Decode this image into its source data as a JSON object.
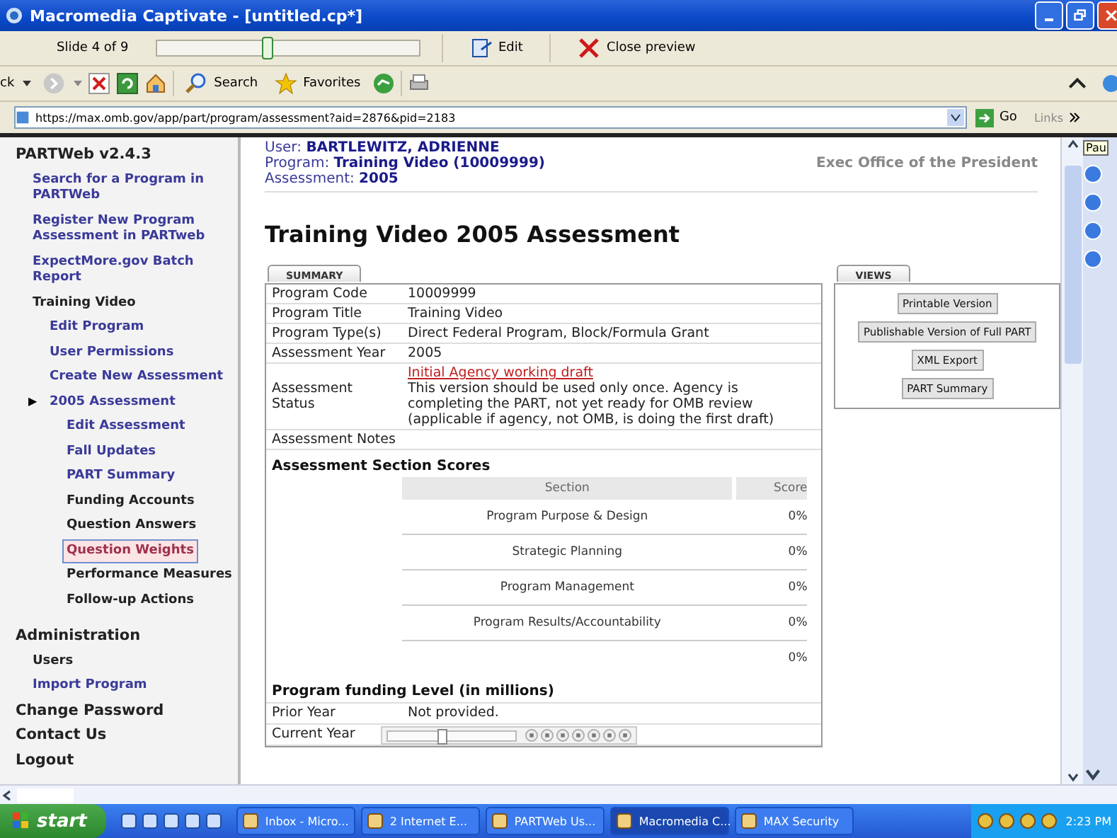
{
  "window": {
    "title": "Macromedia Captivate - [untitled.cp*]"
  },
  "preview_bar": {
    "slide_label": "Slide 4 of 9",
    "progress": {
      "level": 0.42
    },
    "edit_button": "Edit",
    "close_button": "Close preview"
  },
  "browser_toolbar": {
    "back_button": "ck",
    "search_button": "Search",
    "favorites_button": "Favorites"
  },
  "address_bar": {
    "url": "https://max.omb.gov/app/part/program/assessment?aid=2876&pid=2183",
    "go_button": "Go",
    "links_label": "Links"
  },
  "sidebar": {
    "items": [
      {
        "label": "PARTWeb v2.4.3",
        "kind": "heading",
        "selected": false,
        "children": [
          {
            "label": "Search for a Program in PARTWeb",
            "kind": "link",
            "selected": false
          },
          {
            "label": "Register New Program Assessment in PARTweb",
            "kind": "link",
            "selected": false
          },
          {
            "label": "ExpectMore.gov Batch Report",
            "kind": "link",
            "selected": false
          },
          {
            "label": "Training Video",
            "kind": "plain",
            "selected": false,
            "children": [
              {
                "label": "Edit Program",
                "kind": "link",
                "selected": false
              },
              {
                "label": "User Permissions",
                "kind": "link",
                "selected": false
              },
              {
                "label": "Create New Assessment",
                "kind": "link",
                "selected": false
              },
              {
                "label": "2005 Assessment",
                "kind": "link",
                "marker": "▶",
                "selected": false,
                "children": [
                  {
                    "label": "Edit Assessment",
                    "kind": "link",
                    "selected": false
                  },
                  {
                    "label": "Fall Updates",
                    "kind": "link",
                    "selected": false
                  },
                  {
                    "label": "PART Summary",
                    "kind": "link",
                    "selected": false
                  },
                  {
                    "label": "Funding Accounts",
                    "kind": "plain",
                    "selected": false
                  },
                  {
                    "label": "Question Answers",
                    "kind": "plain",
                    "selected": false
                  },
                  {
                    "label": "Question Weights",
                    "kind": "link",
                    "selected": true
                  },
                  {
                    "label": "Performance Measures",
                    "kind": "plain",
                    "selected": false
                  },
                  {
                    "label": "Follow-up Actions",
                    "kind": "plain",
                    "selected": false
                  }
                ]
              }
            ]
          }
        ]
      },
      {
        "label": "Administration",
        "kind": "heading",
        "selected": false,
        "children": [
          {
            "label": "Users",
            "kind": "plain",
            "selected": false
          },
          {
            "label": "Import Program",
            "kind": "link",
            "selected": false
          }
        ]
      },
      {
        "label": "Change Password",
        "kind": "major",
        "selected": false
      },
      {
        "label": "Contact Us",
        "kind": "major",
        "selected": false
      },
      {
        "label": "Logout",
        "kind": "major",
        "selected": false
      }
    ]
  },
  "header": {
    "fields": [
      {
        "label": "User:",
        "value": "BARTLEWITZ, ADRIENNE"
      },
      {
        "label": "Program:",
        "value": "Training Video (10009999)"
      },
      {
        "label": "Assessment:",
        "value": "2005"
      }
    ],
    "agency": "Exec Office of the President"
  },
  "page_title": "Training Video 2005 Assessment",
  "summary": {
    "tab": "SUMMARY",
    "rows": [
      {
        "label": "Program Code",
        "value": "10009999"
      },
      {
        "label": "Program Title",
        "value": "Training Video"
      },
      {
        "label": "Program Type(s)",
        "value": "Direct Federal Program, Block/Formula Grant"
      },
      {
        "label": "Assessment Year",
        "value": "2005"
      },
      {
        "label": "Assessment Status",
        "link": "Initial Agency working draft",
        "value": "This version should be used only once. Agency is completing the PART, not yet ready for OMB review (applicable if agency, not OMB, is doing the first draft)"
      },
      {
        "label": "Assessment Notes"
      }
    ]
  },
  "scores": {
    "heading": "Assessment Section Scores",
    "columns": [
      "Section",
      "Score"
    ],
    "rows": [
      {
        "section": "Program Purpose & Design",
        "score": "0%"
      },
      {
        "section": "Strategic Planning",
        "score": "0%"
      },
      {
        "section": "Program Management",
        "score": "0%"
      },
      {
        "section": "Program Results/Accountability",
        "score": "0%"
      }
    ],
    "total": "0%"
  },
  "funding": {
    "heading": "Program funding Level (in millions)",
    "rows": [
      {
        "label": "Prior Year",
        "value": "Not provided."
      },
      {
        "label": "Current Year"
      }
    ]
  },
  "views": {
    "tab": "VIEWS",
    "buttons": [
      "Printable Version",
      "Publishable Version of Full PART",
      "XML Export",
      "PART Summary"
    ]
  },
  "playback_bar": {
    "level": 0.42
  },
  "side_strip": {
    "tooltip": "Pau"
  },
  "taskbar": {
    "start": "start",
    "tasks": [
      {
        "label": "Inbox - Micro...",
        "selected": false
      },
      {
        "label": "2 Internet E...",
        "selected": false
      },
      {
        "label": "PARTWeb Us...",
        "selected": false
      },
      {
        "label": "Macromedia C...",
        "selected": true
      },
      {
        "label": "MAX Security",
        "selected": false
      }
    ],
    "clock": "2:23 PM"
  }
}
